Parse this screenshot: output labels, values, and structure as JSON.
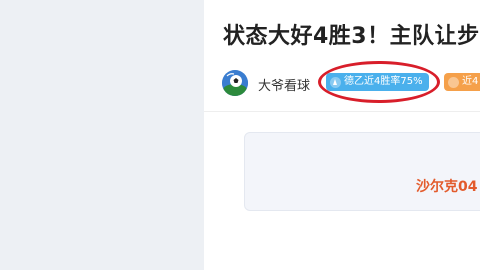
{
  "article": {
    "title": "状态大好4胜3！主队让步"
  },
  "meta": {
    "author_name": "大爷看球",
    "badges": [
      {
        "label": "德乙近4胜率75%",
        "color": "#4ab0ec",
        "icon": "arrow-up-icon"
      },
      {
        "label": "近4",
        "color": "#f5a04a",
        "icon": "star-icon"
      }
    ]
  },
  "match_card": {
    "team_name": "沙尔克04"
  },
  "colors": {
    "accent_blue": "#4ab0ec",
    "accent_orange": "#f5a04a",
    "team_red": "#e35b2c",
    "annotation_red": "#d81e2a"
  }
}
